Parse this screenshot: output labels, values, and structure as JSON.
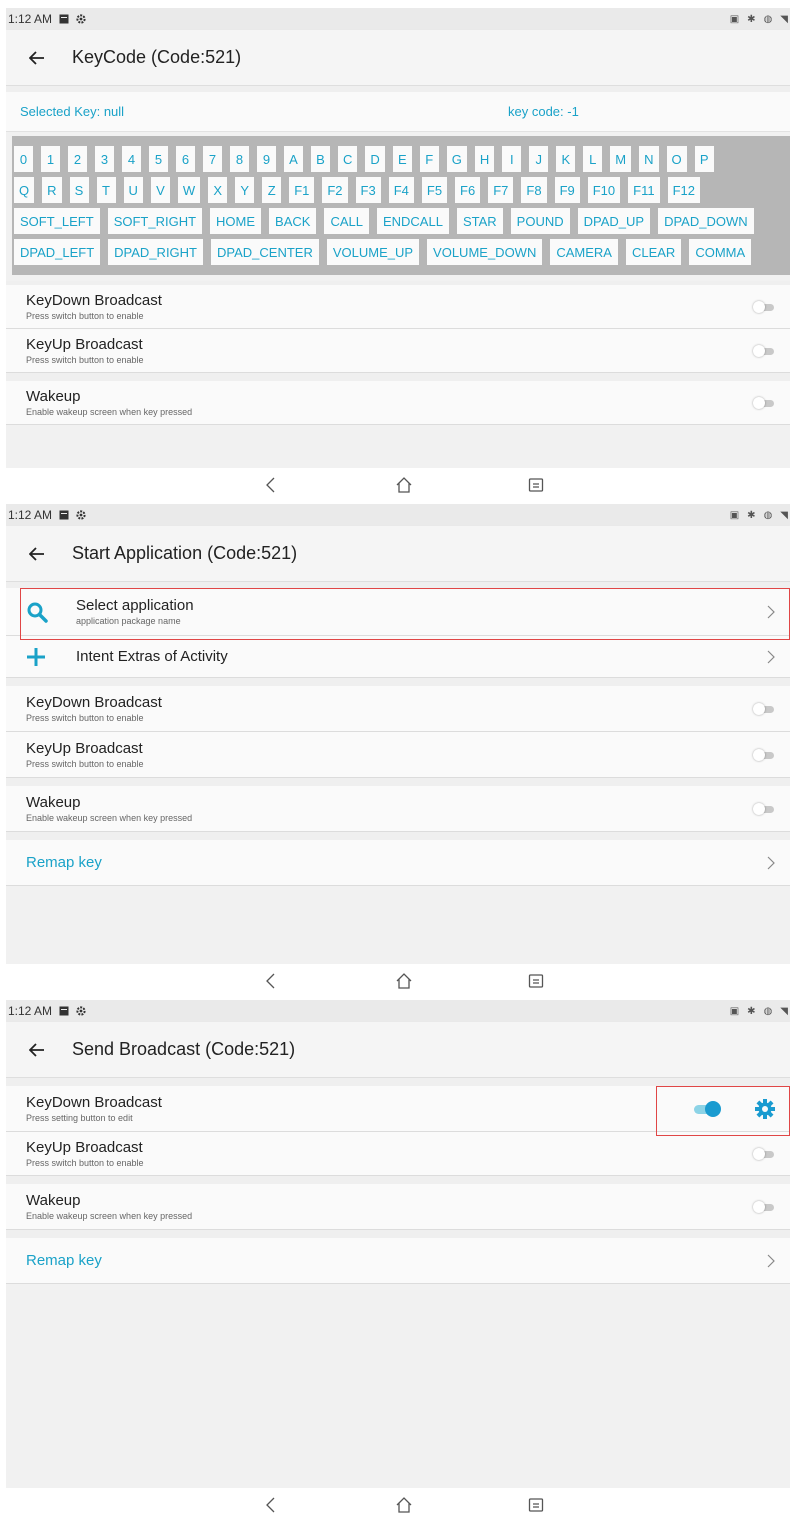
{
  "status": {
    "time": "1:12 AM"
  },
  "screen1": {
    "title": "KeyCode (Code:521)",
    "selected_key": "Selected Key: null",
    "key_code": "key code: -1",
    "keys": {
      "row1": [
        "0",
        "1",
        "2",
        "3",
        "4",
        "5",
        "6",
        "7",
        "8",
        "9",
        "A",
        "B",
        "C",
        "D",
        "E",
        "F",
        "G",
        "H",
        "I",
        "J",
        "K",
        "L",
        "M",
        "N",
        "O",
        "P"
      ],
      "row2": [
        "Q",
        "R",
        "S",
        "T",
        "U",
        "V",
        "W",
        "X",
        "Y",
        "Z",
        "F1",
        "F2",
        "F3",
        "F4",
        "F5",
        "F6",
        "F7",
        "F8",
        "F9",
        "F10",
        "F11",
        "F12"
      ],
      "row3": [
        "SOFT_LEFT",
        "SOFT_RIGHT",
        "HOME",
        "BACK",
        "CALL",
        "ENDCALL",
        "STAR",
        "POUND",
        "DPAD_UP",
        "DPAD_DOWN"
      ],
      "row4": [
        "DPAD_LEFT",
        "DPAD_RIGHT",
        "DPAD_CENTER",
        "VOLUME_UP",
        "VOLUME_DOWN",
        "CAMERA",
        "CLEAR",
        "COMMA"
      ]
    },
    "keydown": {
      "title": "KeyDown Broadcast",
      "sub": "Press switch button to enable"
    },
    "keyup": {
      "title": "KeyUp Broadcast",
      "sub": "Press switch button to enable"
    },
    "wakeup": {
      "title": "Wakeup",
      "sub": "Enable wakeup screen when key pressed"
    }
  },
  "screen2": {
    "title": "Start Application (Code:521)",
    "select_app": {
      "title": "Select application",
      "sub": "application package name"
    },
    "intent": {
      "title": "Intent Extras of Activity"
    },
    "keydown": {
      "title": "KeyDown Broadcast",
      "sub": "Press switch button to enable"
    },
    "keyup": {
      "title": "KeyUp Broadcast",
      "sub": "Press switch button to enable"
    },
    "wakeup": {
      "title": "Wakeup",
      "sub": "Enable wakeup screen when key pressed"
    },
    "remap": "Remap key"
  },
  "screen3": {
    "title": "Send Broadcast (Code:521)",
    "keydown": {
      "title": "KeyDown Broadcast",
      "sub": "Press setting button to edit",
      "enabled": true
    },
    "keyup": {
      "title": "KeyUp Broadcast",
      "sub": "Press switch button to enable"
    },
    "wakeup": {
      "title": "Wakeup",
      "sub": "Enable wakeup screen when key pressed"
    },
    "remap": "Remap key"
  },
  "colors": {
    "accent": "#1aa2c8",
    "toggle_on": "#1a9bd0",
    "highlight": "#e04646"
  },
  "icons": [
    "back-arrow-icon",
    "search-icon",
    "plus-icon",
    "chevron-right-icon",
    "gear-icon",
    "nav-back-icon",
    "nav-home-icon",
    "nav-recents-icon"
  ]
}
